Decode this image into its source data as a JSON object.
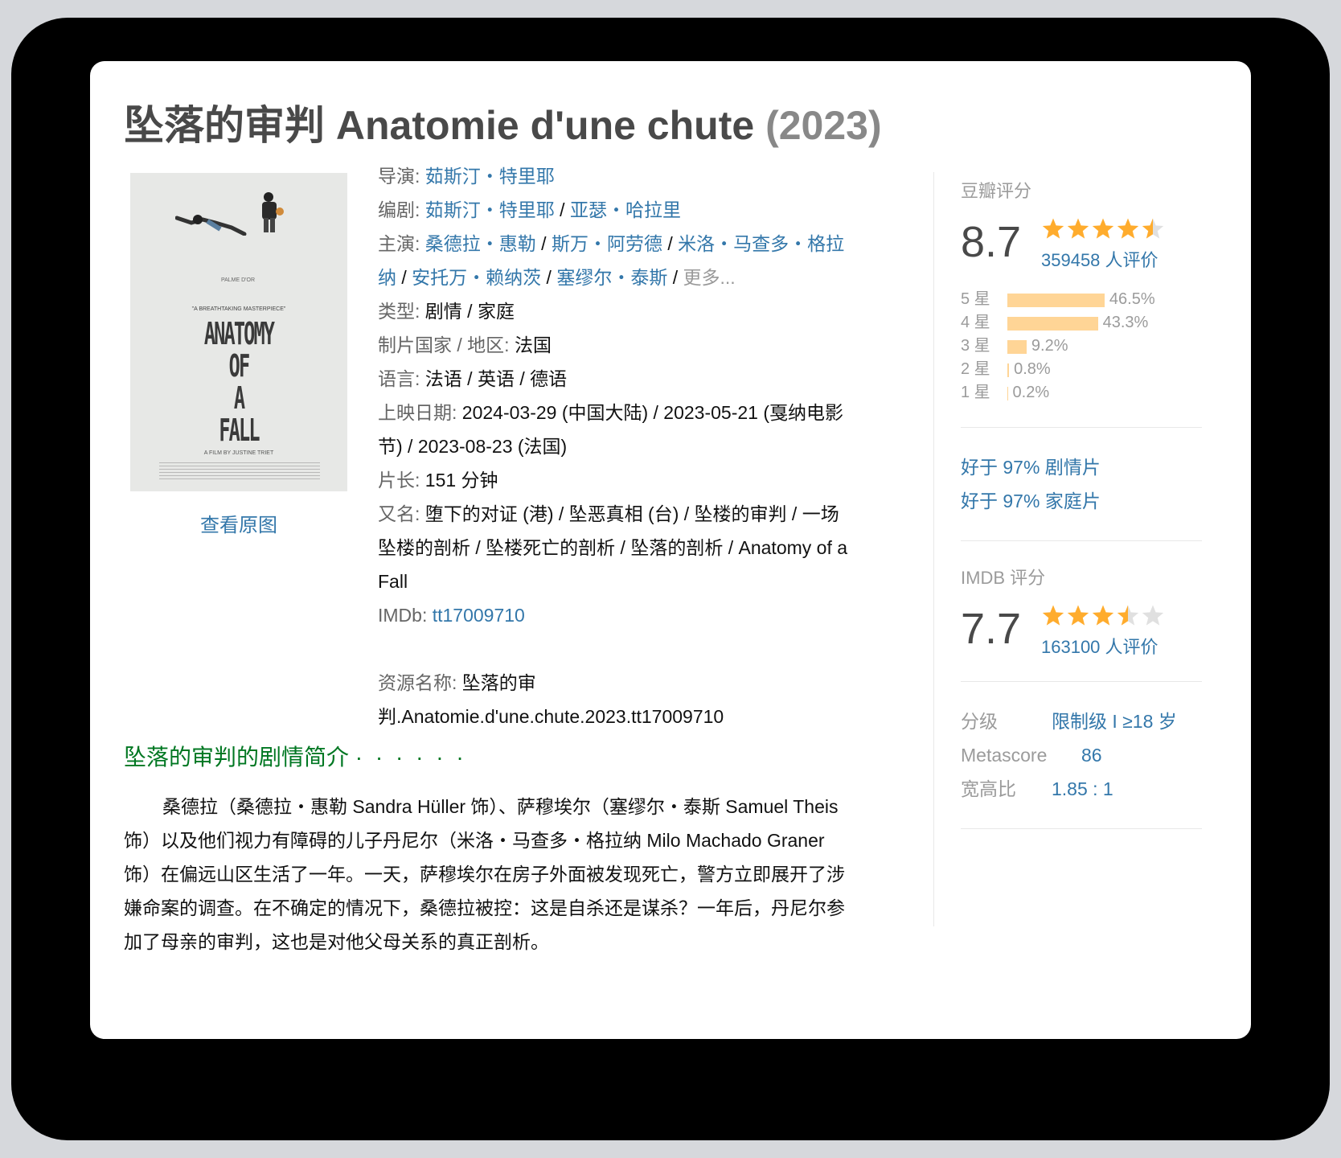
{
  "title": {
    "main": "坠落的审判 Anatomie d'une chute",
    "year": "(2023)"
  },
  "poster": {
    "palme": "PALME D'OR",
    "quote": "\"A BREATHTAKING MASTERPIECE\"",
    "title_lines": [
      "ANATOMY",
      "OF",
      "A",
      "FALL"
    ],
    "credit": "A FILM BY JUSTINE TRIET",
    "view_original": "查看原图"
  },
  "info": {
    "director_label": "导演",
    "director": "茹斯汀・特里耶",
    "writers_label": "编剧",
    "writers": [
      "茹斯汀・特里耶",
      "亚瑟・哈拉里"
    ],
    "cast_label": "主演",
    "cast_line1": [
      "桑德拉・惠勒",
      "斯万・阿劳德",
      "米洛・马查多・格拉"
    ],
    "cast_line2": [
      "纳",
      "安托万・赖纳茨",
      "塞缪尔・泰斯"
    ],
    "more": "更多...",
    "genre_label": "类型",
    "genre": "剧情 / 家庭",
    "country_label": "制片国家 / 地区",
    "country": "法国",
    "language_label": "语言",
    "language": "法语 / 英语 / 德语",
    "release_label": "上映日期",
    "release_line1": "2024-03-29 (中国大陆) / 2023-05-21 (戛纳电影",
    "release_line2": "节) / 2023-08-23 (法国)",
    "runtime_label": "片长",
    "runtime": "151 分钟",
    "aka_label": "又名",
    "aka_line1": "堕下的对证 (港) / 坠恶真相 (台) / 坠楼的审判 / 一场",
    "aka_line2": "坠楼的剖析 / 坠楼死亡的剖析 / 坠落的剖析 / Anatomy of a",
    "aka_line3": "Fall",
    "imdb_label": "IMDb",
    "imdb_id": "tt17009710",
    "resource_label": "资源名称",
    "resource_line1": "坠落的审",
    "resource_line2": "判.Anatomie.d'une.chute.2023.tt17009710"
  },
  "summary": {
    "heading": "坠落的审判的剧情简介",
    "dots": "· · · · · ·",
    "text": "桑德拉（桑德拉・惠勒 Sandra Hüller 饰）、萨穆埃尔（塞缪尔・泰斯 Samuel Theis 饰）以及他们视力有障碍的儿子丹尼尔（米洛・马查多・格拉纳 Milo Machado Graner 饰）在偏远山区生活了一年。一天，萨穆埃尔在房子外面被发现死亡，警方立即展开了涉嫌命案的调查。在不确定的情况下，桑德拉被控：这是自杀还是谋杀？一年后，丹尼尔参加了母亲的审判，这也是对他父母关系的真正剖析。"
  },
  "douban": {
    "label": "豆瓣评分",
    "score": "8.7",
    "stars": 4.5,
    "count": "359458 人评价",
    "distribution": [
      {
        "label": "5 星",
        "percent": 46.5,
        "text": "46.5%"
      },
      {
        "label": "4 星",
        "percent": 43.3,
        "text": "43.3%"
      },
      {
        "label": "3 星",
        "percent": 9.2,
        "text": "9.2%"
      },
      {
        "label": "2 星",
        "percent": 0.8,
        "text": "0.8%"
      },
      {
        "label": "1 星",
        "percent": 0.2,
        "text": "0.2%"
      }
    ]
  },
  "better_than": [
    {
      "prefix": "好于 ",
      "percent": "97%",
      "genre": " 剧情片"
    },
    {
      "prefix": "好于 ",
      "percent": "97%",
      "genre": " 家庭片"
    }
  ],
  "imdb": {
    "label": "IMDB 评分",
    "score": "7.7",
    "stars": 3.5,
    "count": "163100 人评价"
  },
  "meta": {
    "rating_label": "分级",
    "rating_value": "限制级 I ≥18 岁",
    "metascore_label": "Metascore",
    "metascore_value": "86",
    "aspect_label": "宽高比",
    "aspect_value": "1.85 : 1"
  },
  "colors": {
    "link": "#3377aa",
    "star": "#ffac2d",
    "bar": "#ffd596",
    "summary_heading": "#007722"
  }
}
